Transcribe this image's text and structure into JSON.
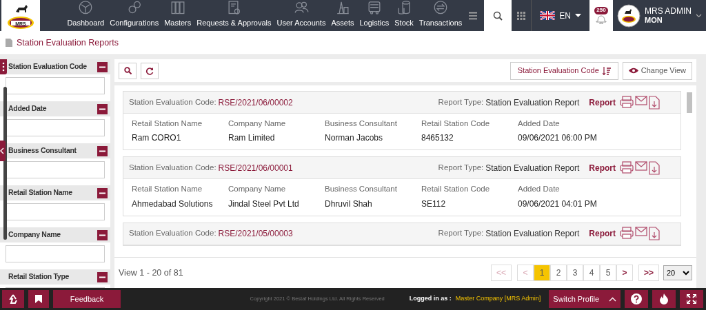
{
  "brand": {
    "logo_text": "MRS"
  },
  "nav": [
    {
      "label": "Dashboard"
    },
    {
      "label": "Configurations"
    },
    {
      "label": "Masters"
    },
    {
      "label": "Requests & Approvals"
    },
    {
      "label": "User Accounts"
    },
    {
      "label": "Assets"
    },
    {
      "label": "Logistics"
    },
    {
      "label": "Stock"
    },
    {
      "label": "Transactions"
    }
  ],
  "language": {
    "code": "EN"
  },
  "notifications": {
    "count": "250"
  },
  "user": {
    "name": "MRS ADMIN",
    "role": "MON"
  },
  "page_title": "Station Evaluation Reports",
  "filters": [
    {
      "label": "Station Evaluation Code",
      "expanded": true
    },
    {
      "label": "Added Date",
      "expanded": true
    },
    {
      "label": "Business Consultant",
      "expanded": true
    },
    {
      "label": "Retail Station Name",
      "expanded": true
    },
    {
      "label": "Company Name",
      "expanded": true
    },
    {
      "label": "Retail Station Type",
      "expanded": true
    }
  ],
  "toolbar": {
    "sort_label": "Station Evaluation Code",
    "view_label": "Change View"
  },
  "records": [
    {
      "code_label": "Station Evaluation Code:",
      "code": "RSE/2021/06/00002",
      "type_label": "Report Type:",
      "type": "Station Evaluation Report",
      "report_link": "Report",
      "fields": [
        {
          "label": "Retail Station Name",
          "value": "Ram CORO1"
        },
        {
          "label": "Company Name",
          "value": "Ram Limited"
        },
        {
          "label": "Business Consultant",
          "value": "Norman Jacobs"
        },
        {
          "label": "Retail Station Code",
          "value": "8465132"
        },
        {
          "label": "Added Date",
          "value": "09/06/2021 06:00 PM"
        }
      ]
    },
    {
      "code_label": "Station Evaluation Code:",
      "code": "RSE/2021/06/00001",
      "type_label": "Report Type:",
      "type": "Station Evaluation Report",
      "report_link": "Report",
      "fields": [
        {
          "label": "Retail Station Name",
          "value": "Ahmedabad Solutions"
        },
        {
          "label": "Company Name",
          "value": "Jindal Steel Pvt Ltd"
        },
        {
          "label": "Business Consultant",
          "value": "Dhruvil Shah"
        },
        {
          "label": "Retail Station Code",
          "value": "SE112"
        },
        {
          "label": "Added Date",
          "value": "09/06/2021 04:01 PM"
        }
      ]
    },
    {
      "code_label": "Station Evaluation Code:",
      "code": "RSE/2021/05/00003",
      "type_label": "Report Type:",
      "type": "Station Evaluation Report",
      "report_link": "Report"
    }
  ],
  "pager": {
    "summary": "View 1 - 20 of 81",
    "first": {
      "label": "<<",
      "disabled": true
    },
    "prev": {
      "label": "<",
      "disabled": true
    },
    "pages": [
      {
        "label": "1",
        "selected": true
      },
      {
        "label": "2",
        "selected": false
      },
      {
        "label": "3",
        "selected": false
      },
      {
        "label": "4",
        "selected": false
      },
      {
        "label": "5",
        "selected": false
      }
    ],
    "next": {
      "label": ">",
      "disabled": false
    },
    "last": {
      "label": ">>",
      "disabled": false
    },
    "page_size": "20"
  },
  "footer": {
    "feedback": "Feedback",
    "copyright": "Copyright 2021 © Bestaf Holdings Ltd. All Rights Reserved",
    "logged_in_label": "Logged in as :",
    "logged_in_value": "Master Company [MRS Admin]",
    "switch_profile": "Switch Profile"
  }
}
